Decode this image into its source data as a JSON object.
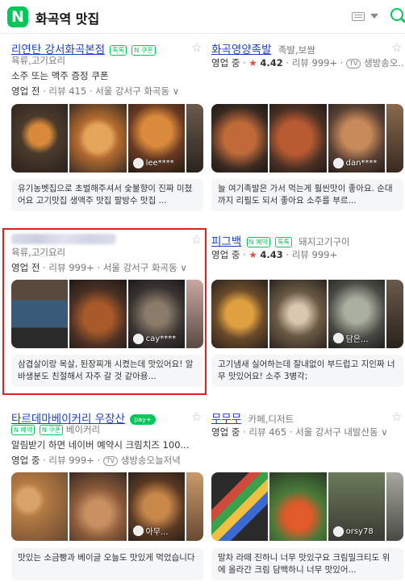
{
  "header": {
    "logo": "N",
    "query": "화곡역 맛집",
    "icons": [
      "keyboard-icon",
      "caret-down-icon",
      "search-icon"
    ]
  },
  "restaurants": [
    {
      "name": "리연탄 강서화곡본점",
      "badges": [
        "톡톡",
        "N 쿠폰"
      ],
      "category": "육류,고기요리",
      "promo": "소주 또는 맥주 증정 쿠폰",
      "status": "영업 전",
      "reviews": "리뷰 415",
      "location": "서울 강서구 화곡동",
      "photo_user": "lee****",
      "review_text": "유기농벳집으로 초벌해주셔서 숯불향이 진짜 미쳤어요 고기맛집 생맥주 맛집 팔방수 맛집 ..."
    },
    {
      "name": "화곡영양족발",
      "category": "족발,보쌈",
      "status": "영업 중",
      "rating": "4.42",
      "reviews": "리뷰 999+",
      "tv": "TV",
      "tv_label": "생방송오...",
      "photo_user": "dan****",
      "review_text": "늘 여기족발은 가서 먹는게 훨씬맛이 좋아요. 순대까지 리필도 되서 좋아요 소주를 부르..."
    },
    {
      "name": "",
      "category": "육류,고기요리",
      "status": "영업 전",
      "reviews": "리뷰 999+",
      "location": "서울 강서구 화곡동",
      "photo_user": "cay****",
      "review_text": "삼겹살이랑 목살, 된장찌개 시켰는데 맛있어요! 알바생분도 친절해서 자주 갈 것 같아용..."
    },
    {
      "name": "피그백",
      "badges": [
        "N 예약",
        "톡톡"
      ],
      "category": "돼지고기구이",
      "status": "영업 중",
      "rating": "4.43",
      "reviews": "리뷰 999+",
      "photo_user": "담은...",
      "review_text": "고기냄새 실어하는데 잘내없이 부드럽고 지인짜 너무 맛있어요! 소주 3병각;"
    },
    {
      "name": "타르데마베이커리 우장산",
      "badges": [
        "pay+"
      ],
      "booking_badge": "N 예약",
      "coupon_badge": "N 쿠폰",
      "category": "베이커리",
      "promo": "알림받기 하면 네이버 예약시 크림치즈 100...",
      "status": "영업 중",
      "reviews": "리뷰 999+",
      "tv": "TV",
      "tv_label": "생방송오늘저녁",
      "photo_user": "아무...",
      "review_text": "맛있는 소금빵과 베이글 오늘도 맛있게 먹었습니다"
    },
    {
      "name": "무무무",
      "category": "카페,디저트",
      "status": "영업 중",
      "reviews": "리뷰 465",
      "location": "서울 강서구 내발산동",
      "photo_user": "orsy78",
      "review_text": "말차 라떼 진하니 너무 맛있구요 크림밀크티도 위에 올라간 크림 담백하니 너무 맛있어..."
    }
  ],
  "colors": {
    "brand": "#03c75a",
    "link": "#1a3fd0",
    "highlight": "#e0201f",
    "star": "#f0463c"
  }
}
